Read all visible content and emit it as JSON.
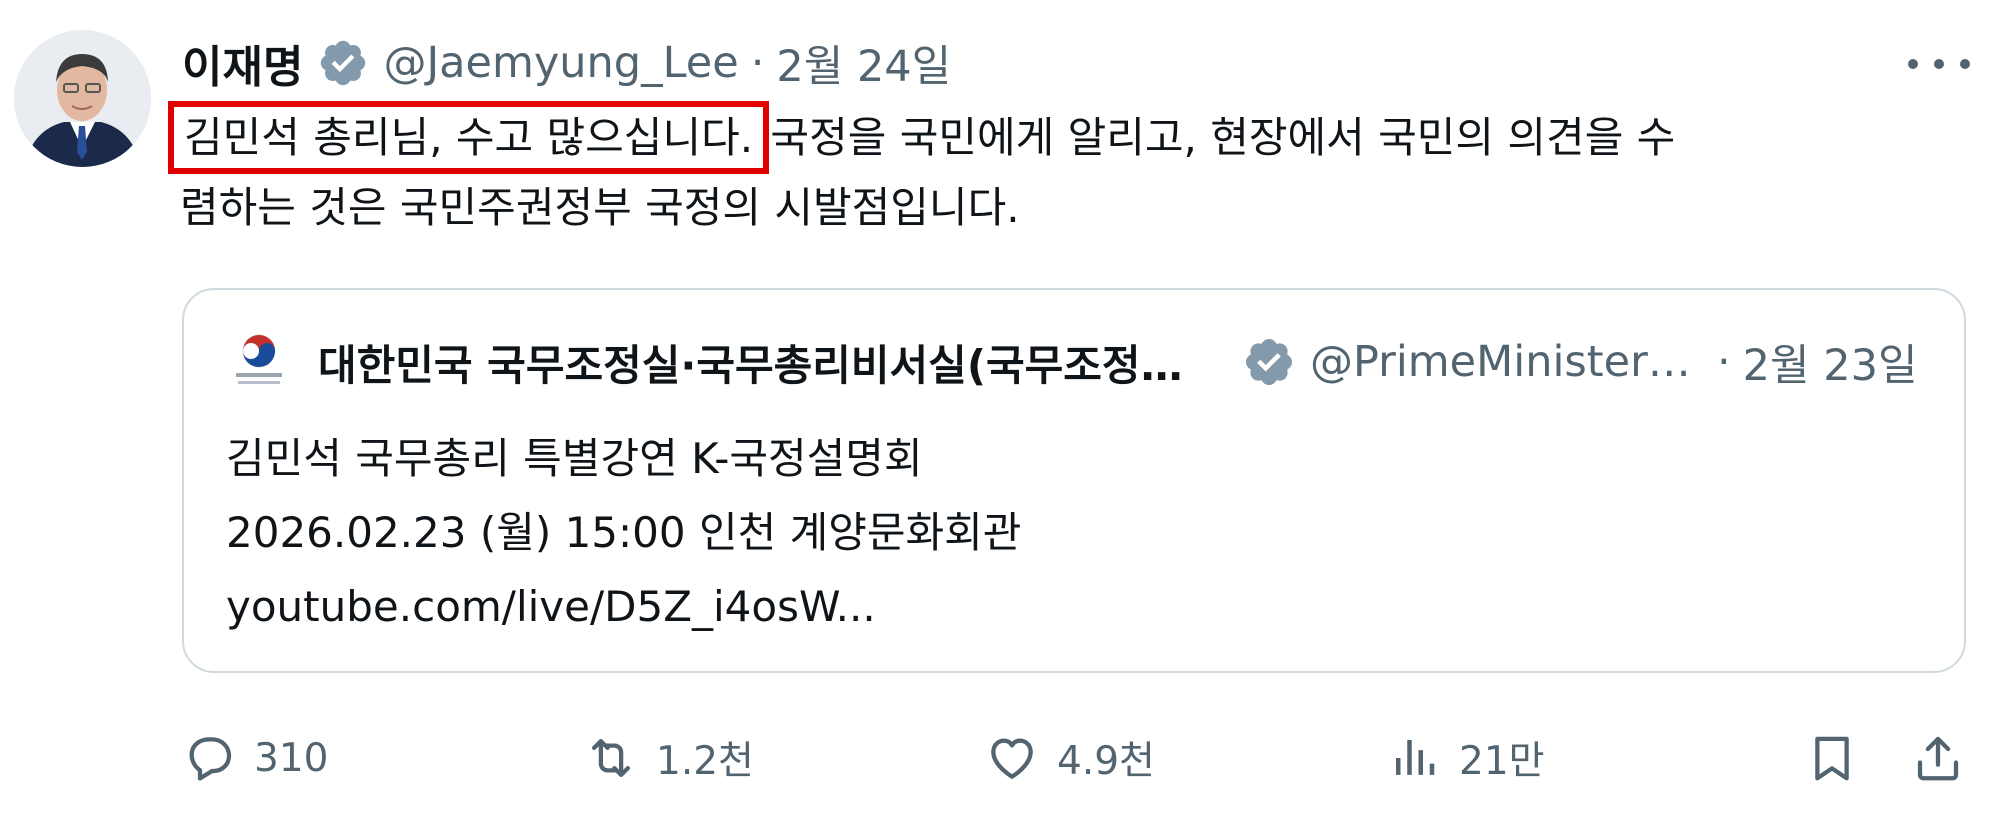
{
  "author": {
    "name": "이재명",
    "handle": "@Jaemyung_Lee",
    "separator": "·",
    "date": "2월 24일"
  },
  "tweet": {
    "highlighted_text": "김민석 총리님, 수고 많으십니다.",
    "line1_rest": " 국정을 국민에게 알리고, 현장에서 국민의 의견을 수",
    "line2": "렴하는 것은 국민주권정부 국정의 시발점입니다."
  },
  "quoted": {
    "name": "대한민국 국무조정실·국무총리비서실(국무조정실·국무총리비서실)",
    "handle": "@PrimeMinisterKR",
    "separator": "·",
    "date": "2월 23일",
    "lines": [
      "김민석 국무총리 특별강연 K-국정설명회",
      "2026.02.23 (월) 15:00 인천 계양문화회관",
      "youtube.com/live/D5Z_i4osW..."
    ]
  },
  "actions": {
    "replies": "310",
    "reposts": "1.2천",
    "likes": "4.9천",
    "views": "21만"
  },
  "icons": {
    "verified": "verified-badge-icon",
    "more": "more-icon",
    "reply": "reply-icon",
    "repost": "repost-icon",
    "like": "heart-icon",
    "views": "views-icon",
    "bookmark": "bookmark-icon",
    "share": "share-icon"
  },
  "colors": {
    "highlight_border": "#e00000",
    "text": "#0f1419",
    "muted": "#536471",
    "verified_badge": "#829aab",
    "quote_border": "#cfd9de"
  }
}
